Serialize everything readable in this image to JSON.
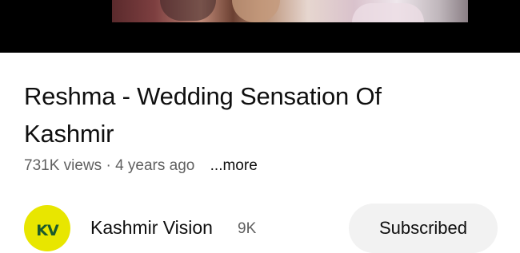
{
  "video": {
    "title": "Reshma - Wedding Sensation Of Kashmir",
    "views": "731K views",
    "separator": "·",
    "age": "4 years ago",
    "more_label": "...more"
  },
  "channel": {
    "avatar_text": "KV",
    "name": "Kashmir Vision",
    "subscribers": "9K",
    "subscribe_label": "Subscribed"
  },
  "colors": {
    "avatar_bg": "#e8e600",
    "avatar_fg": "#1b5a2c",
    "button_bg": "#f2f2f2",
    "secondary_text": "#606060"
  }
}
